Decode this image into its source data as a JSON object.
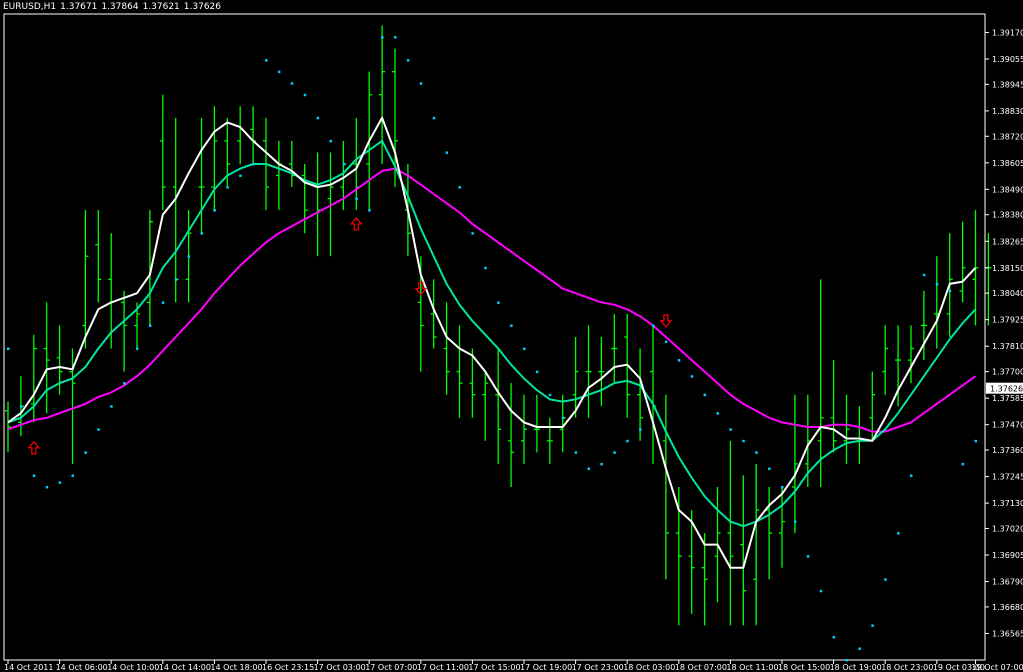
{
  "header": {
    "symbol": "EURUSD,H1",
    "open": "1.37671",
    "high": "1.37864",
    "low": "1.37621",
    "close": "1.37626"
  },
  "chart_data": {
    "type": "bar",
    "style": "ohlc",
    "ylim": [
      1.3645,
      1.3925
    ],
    "bar_count": 75,
    "colors": {
      "background": "#000000",
      "bars": "#00ff00",
      "frame": "#ffffff",
      "ma_fast": "#ffffff",
      "ma_mid": "#00e5a0",
      "ma_slow": "#ff00ff",
      "psar": "#00ccff",
      "arrows": "#ff0000",
      "price_label_bg": "#ffffff",
      "price_label_text": "#000000"
    },
    "y_ticks": [
      "1.39170",
      "1.39055",
      "1.38945",
      "1.38830",
      "1.38720",
      "1.38605",
      "1.38490",
      "1.38380",
      "1.38265",
      "1.38150",
      "1.38040",
      "1.37925",
      "1.37810",
      "1.37700",
      "1.37585",
      "1.37470",
      "1.37360",
      "1.37245",
      "1.37130",
      "1.37020",
      "1.36905",
      "1.36790",
      "1.36680",
      "1.36565"
    ],
    "current_price": "1.37626",
    "x_labels": [
      {
        "i": 0,
        "label": "14 Oct 2011"
      },
      {
        "i": 4,
        "label": "14 Oct 06:00"
      },
      {
        "i": 8,
        "label": "14 Oct 10:00"
      },
      {
        "i": 12,
        "label": "14 Oct 14:00"
      },
      {
        "i": 16,
        "label": "14 Oct 18:00"
      },
      {
        "i": 20,
        "label": "16 Oct 23:15"
      },
      {
        "i": 24,
        "label": "17 Oct 03:00"
      },
      {
        "i": 28,
        "label": "17 Oct 07:00"
      },
      {
        "i": 32,
        "label": "17 Oct 11:00"
      },
      {
        "i": 36,
        "label": "17 Oct 15:00"
      },
      {
        "i": 40,
        "label": "17 Oct 19:00"
      },
      {
        "i": 44,
        "label": "17 Oct 23:00"
      },
      {
        "i": 48,
        "label": "18 Oct 03:00"
      },
      {
        "i": 52,
        "label": "18 Oct 07:00"
      },
      {
        "i": 56,
        "label": "18 Oct 11:00"
      },
      {
        "i": 60,
        "label": "18 Oct 15:00"
      },
      {
        "i": 64,
        "label": "18 Oct 19:00"
      },
      {
        "i": 68,
        "label": "18 Oct 23:00"
      },
      {
        "i": 72,
        "label": "19 Oct 03:00"
      },
      {
        "i": 75,
        "label": "19 Oct 07:00"
      }
    ],
    "ohlc": [
      [
        1.3753,
        1.3757,
        1.3735,
        1.3746
      ],
      [
        1.3748,
        1.3768,
        1.3742,
        1.3755
      ],
      [
        1.3756,
        1.3786,
        1.3748,
        1.378
      ],
      [
        1.378,
        1.38,
        1.3752,
        1.3775
      ],
      [
        1.3776,
        1.379,
        1.376,
        1.377
      ],
      [
        1.377,
        1.378,
        1.373,
        1.3765
      ],
      [
        1.379,
        1.384,
        1.378,
        1.382
      ],
      [
        1.3825,
        1.384,
        1.38,
        1.381
      ],
      [
        1.381,
        1.383,
        1.378,
        1.38
      ],
      [
        1.38,
        1.3805,
        1.377,
        1.379
      ],
      [
        1.379,
        1.38,
        1.378,
        1.3795
      ],
      [
        1.38,
        1.384,
        1.379,
        1.3835
      ],
      [
        1.387,
        1.389,
        1.384,
        1.385
      ],
      [
        1.385,
        1.388,
        1.38,
        1.381
      ],
      [
        1.381,
        1.384,
        1.38,
        1.383
      ],
      [
        1.385,
        1.388,
        1.383,
        1.385
      ],
      [
        1.385,
        1.3885,
        1.384,
        1.387
      ],
      [
        1.387,
        1.388,
        1.385,
        1.386
      ],
      [
        1.387,
        1.3885,
        1.386,
        1.3875
      ],
      [
        1.3875,
        1.3885,
        1.386,
        1.387
      ],
      [
        1.387,
        1.388,
        1.384,
        1.385
      ],
      [
        1.3855,
        1.387,
        1.384,
        1.386
      ],
      [
        1.386,
        1.387,
        1.385,
        1.3855
      ],
      [
        1.3855,
        1.386,
        1.383,
        1.384
      ],
      [
        1.385,
        1.3865,
        1.382,
        1.384
      ],
      [
        1.3845,
        1.3865,
        1.382,
        1.385
      ],
      [
        1.385,
        1.387,
        1.384,
        1.386
      ],
      [
        1.386,
        1.388,
        1.384,
        1.385
      ],
      [
        1.386,
        1.39,
        1.384,
        1.389
      ],
      [
        1.389,
        1.392,
        1.386,
        1.39
      ],
      [
        1.39,
        1.391,
        1.385,
        1.387
      ],
      [
        1.384,
        1.386,
        1.382,
        1.383
      ],
      [
        1.38,
        1.382,
        1.377,
        1.379
      ],
      [
        1.3795,
        1.381,
        1.378,
        1.3785
      ],
      [
        1.378,
        1.38,
        1.376,
        1.377
      ],
      [
        1.377,
        1.379,
        1.375,
        1.3765
      ],
      [
        1.3765,
        1.378,
        1.375,
        1.376
      ],
      [
        1.376,
        1.377,
        1.374,
        1.3765
      ],
      [
        1.376,
        1.378,
        1.373,
        1.3745
      ],
      [
        1.374,
        1.3765,
        1.372,
        1.3735
      ],
      [
        1.374,
        1.376,
        1.373,
        1.3745
      ],
      [
        1.3745,
        1.376,
        1.3735,
        1.3745
      ],
      [
        1.374,
        1.375,
        1.373,
        1.374
      ],
      [
        1.3745,
        1.376,
        1.3735,
        1.375
      ],
      [
        1.376,
        1.3785,
        1.375,
        1.377
      ],
      [
        1.377,
        1.379,
        1.375,
        1.377
      ],
      [
        1.377,
        1.3785,
        1.3755,
        1.377
      ],
      [
        1.378,
        1.3795,
        1.3765,
        1.378
      ],
      [
        1.3785,
        1.3795,
        1.375,
        1.376
      ],
      [
        1.376,
        1.378,
        1.374,
        1.375
      ],
      [
        1.377,
        1.379,
        1.373,
        1.3755
      ],
      [
        1.374,
        1.376,
        1.368,
        1.37
      ],
      [
        1.37,
        1.372,
        1.366,
        1.369
      ],
      [
        1.369,
        1.371,
        1.3665,
        1.3685
      ],
      [
        1.3685,
        1.37,
        1.366,
        1.368
      ],
      [
        1.369,
        1.372,
        1.367,
        1.37
      ],
      [
        1.37,
        1.374,
        1.366,
        1.369
      ],
      [
        1.3695,
        1.3725,
        1.366,
        1.3675
      ],
      [
        1.368,
        1.373,
        1.366,
        1.371
      ],
      [
        1.371,
        1.372,
        1.368,
        1.37
      ],
      [
        1.37,
        1.372,
        1.3685,
        1.3705
      ],
      [
        1.372,
        1.376,
        1.37,
        1.373
      ],
      [
        1.373,
        1.376,
        1.372,
        1.374
      ],
      [
        1.374,
        1.381,
        1.372,
        1.375
      ],
      [
        1.375,
        1.3775,
        1.3735,
        1.374
      ],
      [
        1.374,
        1.376,
        1.373,
        1.3745
      ],
      [
        1.374,
        1.3755,
        1.373,
        1.374
      ],
      [
        1.375,
        1.377,
        1.374,
        1.376
      ],
      [
        1.377,
        1.379,
        1.376,
        1.378
      ],
      [
        1.3775,
        1.379,
        1.3755,
        1.3775
      ],
      [
        1.3775,
        1.379,
        1.3765,
        1.378
      ],
      [
        1.379,
        1.3805,
        1.3775,
        1.379
      ],
      [
        1.3795,
        1.382,
        1.378,
        1.3795
      ],
      [
        1.3795,
        1.383,
        1.3785,
        1.381
      ],
      [
        1.3805,
        1.3835,
        1.38,
        1.3815
      ],
      [
        1.381,
        1.384,
        1.379,
        1.3815
      ],
      [
        1.3815,
        1.383,
        1.379,
        1.3815
      ]
    ],
    "ma_fast": [
      1.3748,
      1.3752,
      1.376,
      1.3771,
      1.3772,
      1.3771,
      1.3785,
      1.3797,
      1.38,
      1.3802,
      1.3804,
      1.3812,
      1.3838,
      1.3845,
      1.3856,
      1.3866,
      1.3874,
      1.3878,
      1.3876,
      1.387,
      1.3865,
      1.386,
      1.3857,
      1.3852,
      1.385,
      1.3851,
      1.3854,
      1.3858,
      1.387,
      1.388,
      1.3865,
      1.384,
      1.3812,
      1.3797,
      1.3785,
      1.378,
      1.3777,
      1.377,
      1.3761,
      1.3753,
      1.3748,
      1.3746,
      1.3746,
      1.3746,
      1.3753,
      1.3763,
      1.3767,
      1.3772,
      1.3773,
      1.3767,
      1.3748,
      1.3728,
      1.371,
      1.3705,
      1.3695,
      1.3695,
      1.3685,
      1.3685,
      1.3705,
      1.3712,
      1.3717,
      1.3725,
      1.3738,
      1.3746,
      1.3745,
      1.3741,
      1.3741,
      1.374,
      1.375,
      1.3762,
      1.3772,
      1.3782,
      1.3792,
      1.3808,
      1.3809,
      1.3815
    ],
    "ma_mid": [
      1.3748,
      1.375,
      1.3755,
      1.3762,
      1.3765,
      1.3767,
      1.3772,
      1.378,
      1.3787,
      1.3792,
      1.3797,
      1.3804,
      1.3815,
      1.3822,
      1.3831,
      1.384,
      1.3849,
      1.3855,
      1.3858,
      1.386,
      1.386,
      1.3858,
      1.3856,
      1.3853,
      1.3851,
      1.3853,
      1.3856,
      1.3862,
      1.3866,
      1.387,
      1.3859,
      1.3846,
      1.3832,
      1.382,
      1.3808,
      1.3799,
      1.3792,
      1.3786,
      1.378,
      1.3773,
      1.3767,
      1.3762,
      1.3758,
      1.3757,
      1.3758,
      1.376,
      1.3762,
      1.3765,
      1.3766,
      1.3764,
      1.3756,
      1.3744,
      1.3733,
      1.3724,
      1.3716,
      1.371,
      1.3705,
      1.3703,
      1.3705,
      1.3708,
      1.3712,
      1.3718,
      1.3726,
      1.3732,
      1.3736,
      1.3739,
      1.374,
      1.374,
      1.3745,
      1.3752,
      1.376,
      1.3768,
      1.3776,
      1.3784,
      1.3791,
      1.3797
    ],
    "ma_slow": [
      1.3745,
      1.3747,
      1.3749,
      1.375,
      1.3752,
      1.3754,
      1.3756,
      1.3759,
      1.3761,
      1.3764,
      1.3768,
      1.3773,
      1.3779,
      1.3785,
      1.3791,
      1.3797,
      1.3804,
      1.381,
      1.3816,
      1.3821,
      1.3826,
      1.383,
      1.3833,
      1.3836,
      1.3839,
      1.3842,
      1.3845,
      1.3849,
      1.3853,
      1.3857,
      1.3858,
      1.3855,
      1.3851,
      1.3847,
      1.3843,
      1.3839,
      1.3834,
      1.383,
      1.3826,
      1.3822,
      1.3818,
      1.3814,
      1.381,
      1.3806,
      1.3804,
      1.3802,
      1.38,
      1.3799,
      1.3797,
      1.3794,
      1.379,
      1.3785,
      1.378,
      1.3775,
      1.377,
      1.3765,
      1.376,
      1.3756,
      1.3753,
      1.375,
      1.3748,
      1.3747,
      1.3746,
      1.3746,
      1.3747,
      1.3747,
      1.3746,
      1.3744,
      1.3744,
      1.3746,
      1.3748,
      1.3752,
      1.3756,
      1.376,
      1.3764,
      1.3768
    ],
    "psar": [
      1.378,
      1.3755,
      1.3725,
      1.372,
      1.3722,
      1.3725,
      1.3735,
      1.3745,
      1.3755,
      1.3765,
      1.378,
      1.379,
      1.38,
      1.381,
      1.382,
      1.383,
      1.384,
      1.385,
      1.3855,
      1.386,
      1.3905,
      1.39,
      1.3895,
      1.389,
      1.388,
      1.387,
      1.386,
      1.3845,
      1.384,
      1.3915,
      1.3915,
      1.3905,
      1.3895,
      1.388,
      1.3865,
      1.385,
      1.383,
      1.3815,
      1.38,
      1.379,
      1.378,
      1.377,
      1.376,
      1.375,
      1.3735,
      1.3728,
      1.373,
      1.3735,
      1.374,
      1.3745,
      1.379,
      1.3783,
      1.3775,
      1.3768,
      1.376,
      1.3752,
      1.3745,
      1.374,
      1.3735,
      1.3728,
      1.372,
      1.3705,
      1.369,
      1.3675,
      1.3655,
      1.3645,
      1.365,
      1.366,
      1.368,
      1.37,
      1.3725,
      1.3812,
      1.3808,
      1.3805,
      1.373,
      1.374
    ],
    "arrows": [
      {
        "i": 2,
        "dir": "up",
        "price": 1.3737
      },
      {
        "i": 27,
        "dir": "up",
        "price": 1.3834
      },
      {
        "i": 32,
        "dir": "down",
        "price": 1.3806
      },
      {
        "i": 51,
        "dir": "down",
        "price": 1.3792
      }
    ]
  }
}
